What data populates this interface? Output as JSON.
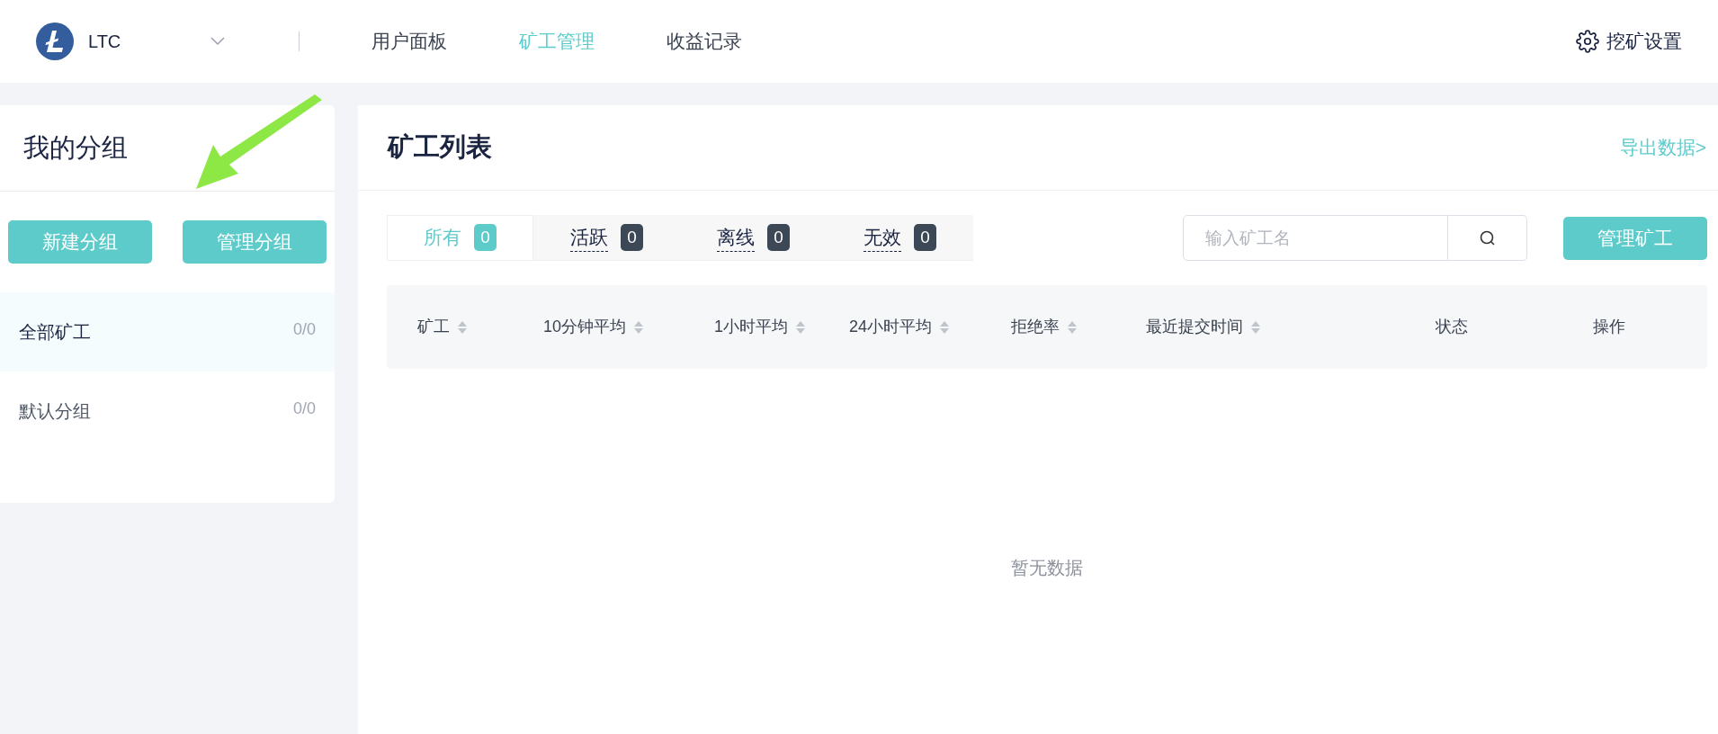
{
  "header": {
    "coin": "LTC",
    "nav": [
      {
        "label": "用户面板",
        "selected": false
      },
      {
        "label": "矿工管理",
        "selected": true
      },
      {
        "label": "收益记录",
        "selected": false
      }
    ],
    "settings": "挖矿设置"
  },
  "groups": {
    "title": "我的分组",
    "buttons": [
      "新建分组",
      "管理分组"
    ],
    "items": [
      {
        "name": "全部矿工",
        "count": "0/0",
        "selected": true
      },
      {
        "name": "默认分组",
        "count": "0/0",
        "selected": false
      }
    ]
  },
  "miners": {
    "title": "矿工列表",
    "export": "导出数据>",
    "tabs": [
      {
        "label": "所有",
        "count": "0",
        "selected": true
      },
      {
        "label": "活跃",
        "count": "0",
        "selected": false
      },
      {
        "label": "离线",
        "count": "0",
        "selected": false
      },
      {
        "label": "无效",
        "count": "0",
        "selected": false
      }
    ],
    "search": {
      "placeholder": "输入矿工名"
    },
    "manage": "管理矿工",
    "columns": [
      {
        "label": "矿工",
        "sortable": true
      },
      {
        "label": "10分钟平均",
        "sortable": true
      },
      {
        "label": "1小时平均",
        "sortable": true
      },
      {
        "label": "24小时平均",
        "sortable": true
      },
      {
        "label": "拒绝率",
        "sortable": true
      },
      {
        "label": "最近提交时间",
        "sortable": true
      },
      {
        "label": "状态",
        "sortable": false
      },
      {
        "label": "操作",
        "sortable": false
      }
    ],
    "empty": "暂无数据"
  }
}
